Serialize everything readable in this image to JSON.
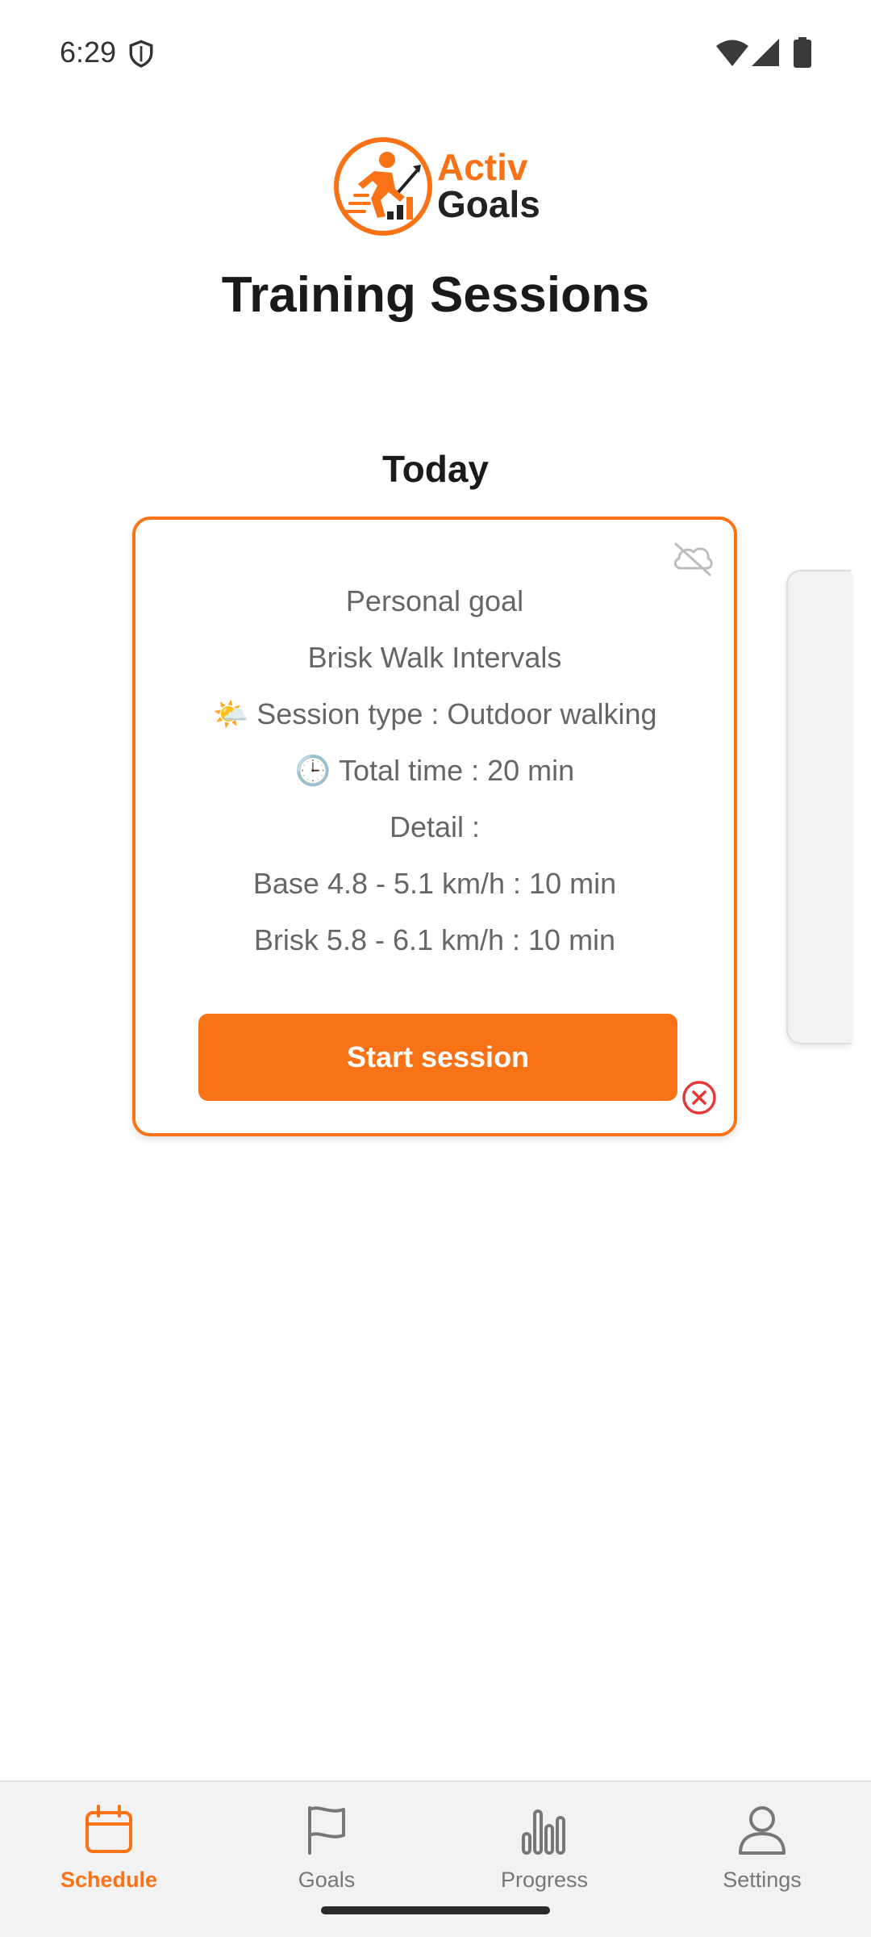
{
  "status_bar": {
    "time": "6:29"
  },
  "header": {
    "logo": {
      "line1": "Activ",
      "line2": "Goals"
    },
    "title": "Training Sessions"
  },
  "section": {
    "title": "Today"
  },
  "session_card": {
    "lines": [
      "Personal goal",
      "Brisk Walk Intervals",
      "Session type : Outdoor walking",
      "Total time : 20 min",
      "Detail :",
      "Base 4.8 - 5.1 km/h : 10 min",
      "Brisk 5.8 - 6.1 km/h : 10 min"
    ],
    "session_type_emoji": "🌤️",
    "total_time_emoji": "🕒",
    "start_label": "Start session",
    "icons": {
      "sync": "cloud-off-icon",
      "dismiss": "close-circle-icon"
    }
  },
  "bottom_nav": {
    "items": [
      {
        "label": "Schedule",
        "icon": "calendar-icon",
        "active": true
      },
      {
        "label": "Goals",
        "icon": "flag-icon",
        "active": false
      },
      {
        "label": "Progress",
        "icon": "bar-chart-icon",
        "active": false
      },
      {
        "label": "Settings",
        "icon": "person-icon",
        "active": false
      }
    ]
  },
  "colors": {
    "accent": "#f97316",
    "danger": "#e53935",
    "text_primary": "#1a1a1a",
    "text_secondary": "#666666",
    "nav_background": "#f2f2f2"
  }
}
